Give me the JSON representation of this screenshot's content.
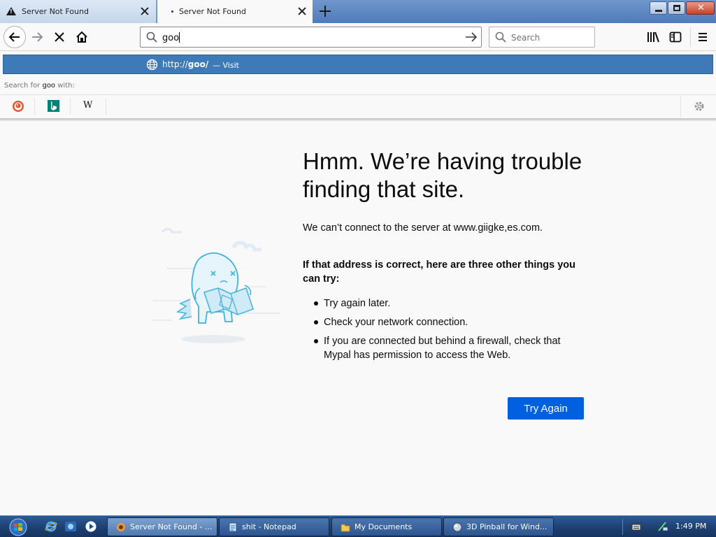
{
  "tabs": [
    {
      "title": "Server Not Found",
      "active": false
    },
    {
      "title": "Server Not Found",
      "active": true
    }
  ],
  "navbar": {
    "url_value": "goo",
    "search_placeholder": "Search"
  },
  "dropdown": {
    "suggestion_prefix": "http://",
    "suggestion_host": "goo/",
    "suggestion_action": "— Visit",
    "search_with_prefix": "Search for ",
    "search_with_term": "goo",
    "search_with_suffix": " with:",
    "engines": [
      "duckduckgo-icon",
      "bing-icon",
      "wikipedia-icon"
    ],
    "wiki_letter": "W"
  },
  "error": {
    "title": "Hmm. We’re having trouble finding that site.",
    "description": "We can’t connect to the server at www.giigke,es.com.",
    "subtitle": "If that address is correct, here are three other things you can try:",
    "tips": [
      "Try again later.",
      "Check your network connection.",
      "If you are connected but behind a firewall, check that Mypal has permission to access the Web."
    ],
    "button": "Try Again"
  },
  "taskbar": {
    "tasks": [
      {
        "label": "Server Not Found - ...",
        "active": true
      },
      {
        "label": "shit - Notepad",
        "active": false
      },
      {
        "label": "My Documents",
        "active": false
      },
      {
        "label": "3D Pinball for Wind...",
        "active": false
      }
    ],
    "clock": "1:49 PM"
  },
  "colors": {
    "accent": "#0060df",
    "suggestion_bg": "#3f7ab8",
    "taskbar": "#1f4274"
  }
}
